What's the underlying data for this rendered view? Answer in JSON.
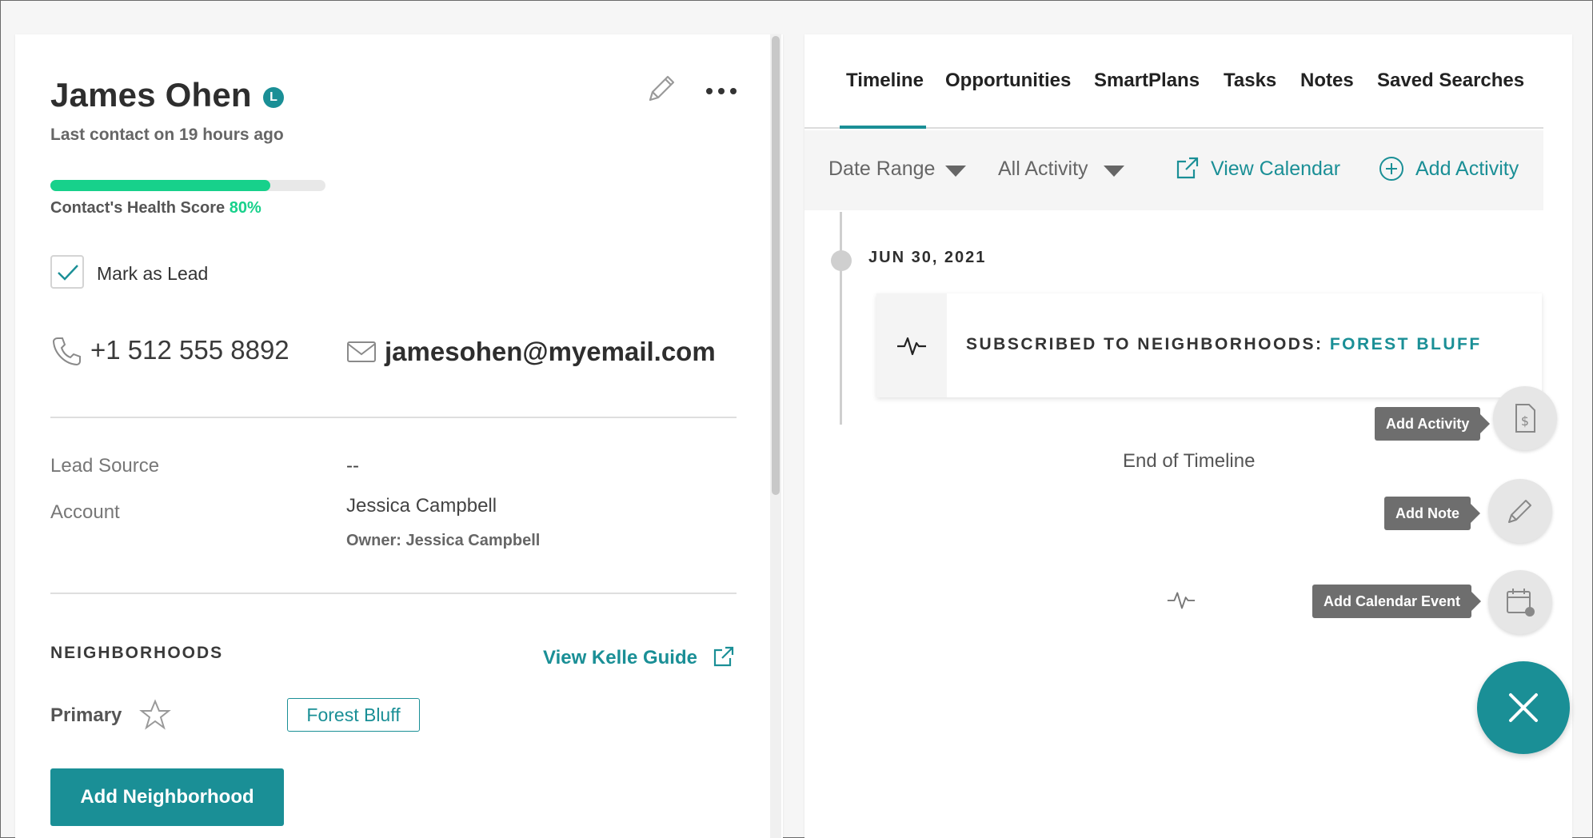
{
  "contact": {
    "name": "James Ohen",
    "lead_badge": "L",
    "last_contact": "Last contact on 19 hours ago",
    "health_label": "Contact's Health Score",
    "health_score": "80%",
    "health_fraction": 0.8,
    "mark_as_lead_label": "Mark as Lead",
    "mark_as_lead_checked": true,
    "phone": "+1 512 555 8892",
    "email": "jamesohen@myemail.com"
  },
  "details": {
    "lead_source_label": "Lead Source",
    "lead_source_value": "--",
    "account_label": "Account",
    "account_value": "Jessica Campbell",
    "owner": "Owner: Jessica Campbell"
  },
  "neighborhoods": {
    "title": "NEIGHBORHOODS",
    "guide_link": "View Kelle Guide",
    "primary_label": "Primary",
    "primary_value": "Forest Bluff",
    "add_button": "Add Neighborhood"
  },
  "tabs": [
    "Timeline",
    "Opportunities",
    "SmartPlans",
    "Tasks",
    "Notes",
    "Saved Searches"
  ],
  "active_tab": "Timeline",
  "filters": {
    "date_range": "Date Range",
    "activity": "All Activity",
    "view_calendar": "View Calendar",
    "add_activity": "Add Activity"
  },
  "timeline": {
    "date": "JUN 30, 2021",
    "event_prefix": "SUBSCRIBED TO NEIGHBORHOODS:",
    "event_value": "FOREST BLUFF",
    "end_label": "End of Timeline"
  },
  "speed_dial": {
    "add_activity": "Add Activity",
    "add_note": "Add Note",
    "add_calendar_event": "Add Calendar Event"
  },
  "colors": {
    "accent": "#1a8f96",
    "health": "#17d18b"
  }
}
